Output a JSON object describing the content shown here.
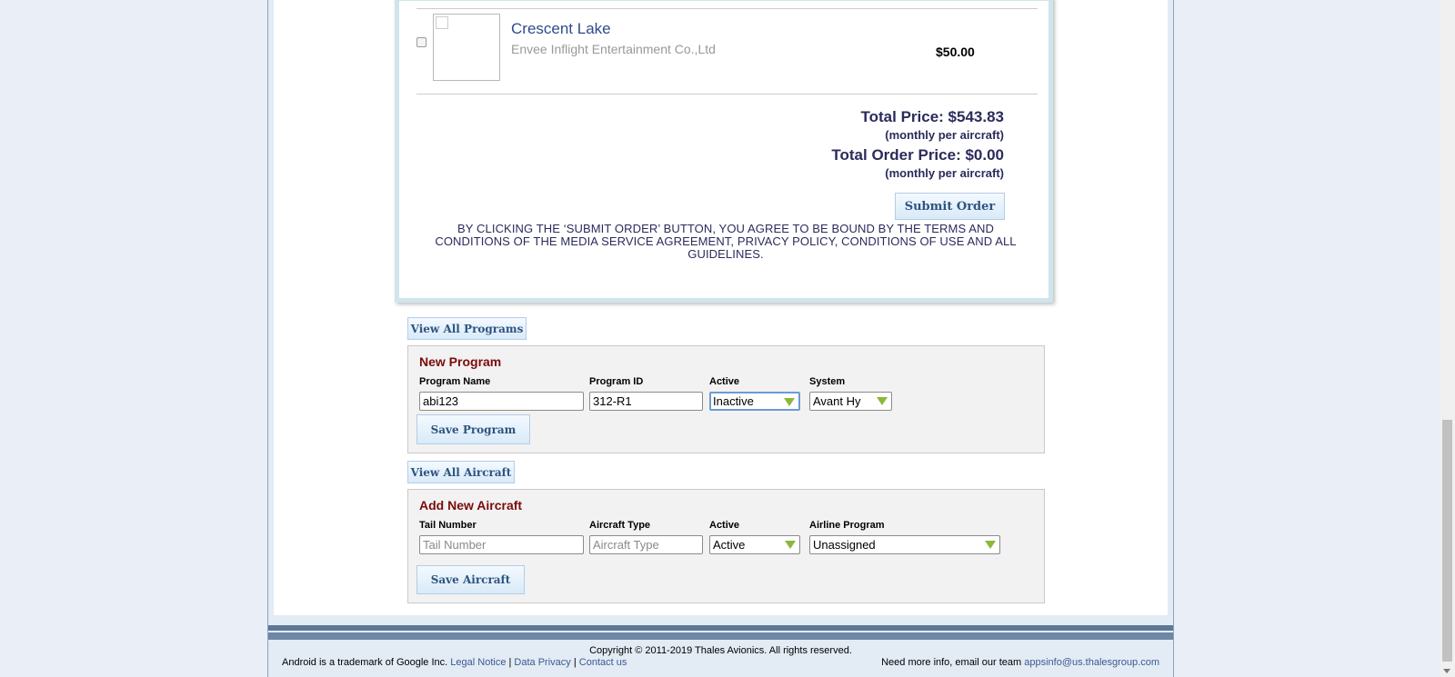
{
  "cart": {
    "item": {
      "title": "Crescent Lake",
      "vendor": "Envee Inflight Entertainment Co.,Ltd",
      "price": "$50.00",
      "checked": false
    },
    "total_price": "Total Price: $543.83",
    "total_price_note": "(monthly per aircraft)",
    "total_order_price": "Total Order Price: $0.00",
    "total_order_price_note": "(monthly per aircraft)",
    "submit_label": "Submit Order",
    "terms": "BY CLICKING THE ‘SUBMIT ORDER’ BUTTON, YOU AGREE TO BE BOUND BY THE TERMS AND CONDITIONS OF THE MEDIA SERVICE AGREEMENT, PRIVACY POLICY, CONDITIONS OF USE AND ALL GUIDELINES."
  },
  "programs": {
    "view_all_label": "View All Programs",
    "form_title": "New Program",
    "name_label": "Program Name",
    "name_value": "abi123",
    "id_label": "Program ID",
    "id_value": "312-R1",
    "active_label": "Active",
    "active_value": "Inactive",
    "system_label": "System",
    "system_value": "Avant Hy",
    "save_label": "Save Program"
  },
  "aircraft": {
    "view_all_label": "View All Aircraft",
    "form_title": "Add New Aircraft",
    "tail_label": "Tail Number",
    "tail_placeholder": "Tail Number",
    "type_label": "Aircraft Type",
    "type_placeholder": "Aircraft Type",
    "active_label": "Active",
    "active_value": "Active",
    "program_label": "Airline Program",
    "program_value": "Unassigned",
    "save_label": "Save Aircraft"
  },
  "footer": {
    "copyright": "Copyright © 2011-2019 Thales Avionics. All rights reserved.",
    "android_note": "Android is a trademark of Google Inc.",
    "legal_notice": "Legal Notice",
    "data_privacy": "Data Privacy",
    "contact_us": "Contact us",
    "separator": "|",
    "more_info": "Need more info, email our team",
    "email": "appsinfo@us.thalesgroup.com"
  },
  "colors": {
    "form_title": "#7a0b0b",
    "link": "#3a5a8f",
    "dropdown_arrow": "#8cb83a"
  }
}
